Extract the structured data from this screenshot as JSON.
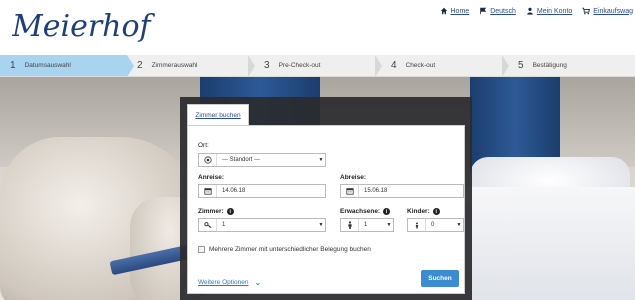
{
  "header": {
    "logo_text": "Meierhof",
    "nav": [
      {
        "label": "Home",
        "icon": "home-icon"
      },
      {
        "label": "Deutsch",
        "icon": "flag-icon"
      },
      {
        "label": "Mein Konto",
        "icon": "user-icon"
      },
      {
        "label": "Einkaufswag",
        "icon": "cart-icon"
      }
    ]
  },
  "steps": [
    {
      "num": "1",
      "label": "Datumsauswahl",
      "active": true
    },
    {
      "num": "2",
      "label": "Zimmerauswahl",
      "active": false
    },
    {
      "num": "3",
      "label": "Pre-Check-out",
      "active": false
    },
    {
      "num": "4",
      "label": "Check-out",
      "active": false
    },
    {
      "num": "5",
      "label": "Bestätigung",
      "active": false
    }
  ],
  "booking": {
    "tab_label": "Zimmer buchen",
    "location_label": "Ort:",
    "location_value": "--- Standort ---",
    "arrival_label": "Anreise:",
    "arrival_value": "14.06.18",
    "departure_label": "Abreise:",
    "departure_value": "15.06.18",
    "rooms_label": "Zimmer:",
    "rooms_value": "1",
    "adults_label": "Erwachsene:",
    "adults_value": "1",
    "children_label": "Kinder:",
    "children_value": "0",
    "multi_room_label": "Mehrere Zimmer mit unterschiedlicher Belegung buchen",
    "more_options_label": "Weitere Optionen",
    "search_label": "Suchen"
  },
  "colors": {
    "accent": "#3b8cd0",
    "active_step": "#a8d4ef",
    "link": "#2a4d8f",
    "panel": "#2a2a2e"
  }
}
